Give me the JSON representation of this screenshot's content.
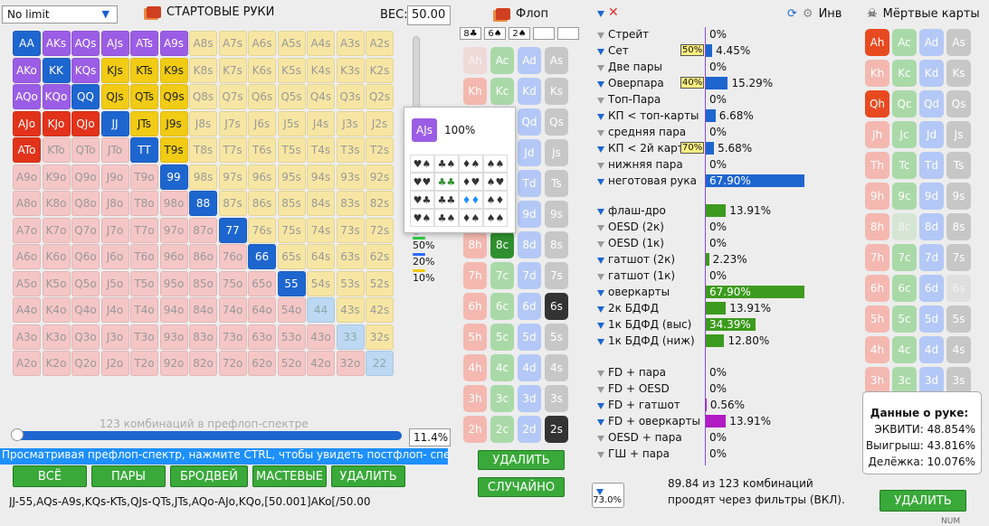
{
  "toolbar": {
    "limit": "No limit",
    "starting_hands": "СТАРТОВЫЕ РУКИ",
    "weight_label": "ВЕС:",
    "weight_value": "50.00"
  },
  "colors": {
    "pair_on": "#1e66cf",
    "suited_on": "#f1cb14",
    "offsuit_on": "#e2331a",
    "half": "#9b5de5",
    "accent_green": "#39a939"
  },
  "grid": {
    "rows": [
      [
        "AA",
        "AKs",
        "AQs",
        "AJs",
        "ATs",
        "A9s",
        "A8s",
        "A7s",
        "A6s",
        "A5s",
        "A4s",
        "A3s",
        "A2s"
      ],
      [
        "AKo",
        "KK",
        "KQs",
        "KJs",
        "KTs",
        "K9s",
        "K8s",
        "K7s",
        "K6s",
        "K5s",
        "K4s",
        "K3s",
        "K2s"
      ],
      [
        "AQo",
        "KQo",
        "QQ",
        "QJs",
        "QTs",
        "Q9s",
        "Q8s",
        "Q7s",
        "Q6s",
        "Q5s",
        "Q4s",
        "Q3s",
        "Q2s"
      ],
      [
        "AJo",
        "KJo",
        "QJo",
        "JJ",
        "JTs",
        "J9s",
        "J8s",
        "J7s",
        "J6s",
        "J5s",
        "J4s",
        "J3s",
        "J2s"
      ],
      [
        "ATo",
        "KTo",
        "QTo",
        "JTo",
        "TT",
        "T9s",
        "T8s",
        "T7s",
        "T6s",
        "T5s",
        "T4s",
        "T3s",
        "T2s"
      ],
      [
        "A9o",
        "K9o",
        "Q9o",
        "J9o",
        "T9o",
        "99",
        "98s",
        "97s",
        "96s",
        "95s",
        "94s",
        "93s",
        "92s"
      ],
      [
        "A8o",
        "K8o",
        "Q8o",
        "J8o",
        "T8o",
        "98o",
        "88",
        "87s",
        "86s",
        "85s",
        "84s",
        "83s",
        "82s"
      ],
      [
        "A7o",
        "K7o",
        "Q7o",
        "J7o",
        "T7o",
        "97o",
        "87o",
        "77",
        "76s",
        "75s",
        "74s",
        "73s",
        "72s"
      ],
      [
        "A6o",
        "K6o",
        "Q6o",
        "J6o",
        "T6o",
        "96o",
        "86o",
        "76o",
        "66",
        "65s",
        "64s",
        "63s",
        "62s"
      ],
      [
        "A5o",
        "K5o",
        "Q5o",
        "J5o",
        "T5o",
        "95o",
        "85o",
        "75o",
        "65o",
        "55",
        "54s",
        "53s",
        "52s"
      ],
      [
        "A4o",
        "K4o",
        "Q4o",
        "J4o",
        "T4o",
        "94o",
        "84o",
        "74o",
        "64o",
        "54o",
        "44",
        "43s",
        "42s"
      ],
      [
        "A3o",
        "K3o",
        "Q3o",
        "J3o",
        "T3o",
        "93o",
        "83o",
        "73o",
        "63o",
        "53o",
        "43o",
        "33",
        "32s"
      ],
      [
        "A2o",
        "K2o",
        "Q2o",
        "J2o",
        "T2o",
        "92o",
        "82o",
        "72o",
        "62o",
        "52o",
        "42o",
        "32o",
        "22"
      ]
    ],
    "selected": [
      "AA",
      "AKs",
      "AQs",
      "AJs",
      "ATs",
      "A9s",
      "AKo",
      "KK",
      "KQs",
      "KJs",
      "KTs",
      "K9s",
      "AQo",
      "KQo",
      "QQ",
      "QJs",
      "QTs",
      "Q9s",
      "AJo",
      "KJo",
      "QJo",
      "JJ",
      "JTs",
      "J9s",
      "ATo",
      "TT",
      "T9s",
      "99",
      "88",
      "77",
      "66",
      "55"
    ],
    "half": [
      "AKs",
      "AQs",
      "AJs",
      "ATs",
      "A9s",
      "AKo",
      "KQs",
      "AQo",
      "KQo"
    ]
  },
  "combo_text": "123 комбинаций в префлоп-спектре",
  "range_pct": "11.4%",
  "hint": "Просматривая префлоп-спектр, нажмите CTRL, чтобы увидеть постфлоп- спектр.",
  "buttons": {
    "all": "ВСЁ",
    "pairs": "ПАРЫ",
    "broadway": "БРОДВЕЙ",
    "suited": "МАСТЕВЫЕ",
    "delete": "УДАЛИТЬ",
    "random": "СЛУЧАЙНО"
  },
  "range_string": "JJ-55,AQs-A9s,KQs-KTs,QJs-QTs,JTs,AQo-AJo,KQo,[50.001]AKo[/50.00",
  "legend": [
    "50%",
    "20%",
    "10%"
  ],
  "popup": {
    "hand": "AJs",
    "pct": "100%"
  },
  "flop": {
    "title": "Флоп",
    "slots": [
      "8♣",
      "6♠",
      "2♠",
      "",
      ""
    ],
    "ranks": [
      "A",
      "K",
      "Q",
      "J",
      "T",
      "9",
      "8",
      "7",
      "6",
      "5",
      "4",
      "3",
      "2"
    ]
  },
  "stats": {
    "made": [
      {
        "label": "Стрейт",
        "val": "0%",
        "w": 0
      },
      {
        "label": "Сет",
        "val": "4.45%",
        "w": 4.45,
        "badge": "50%"
      },
      {
        "label": "Две пары",
        "val": "0%",
        "w": 0
      },
      {
        "label": "Оверпара",
        "val": "15.29%",
        "w": 15.29,
        "badge": "40%"
      },
      {
        "label": "Топ-Пара",
        "val": "0%",
        "w": 0
      },
      {
        "label": "КП < топ-карты",
        "val": "6.68%",
        "w": 6.68
      },
      {
        "label": "средняя пара",
        "val": "0%",
        "w": 0
      },
      {
        "label": "КП < 2й карт",
        "val": "5.68%",
        "w": 5.68,
        "badge": "70%"
      },
      {
        "label": "нижняя пара",
        "val": "0%",
        "w": 0
      },
      {
        "label": "неготовая рука",
        "val": "67.90%",
        "w": 67.9
      }
    ],
    "draws": [
      {
        "label": "флаш-дро",
        "val": "13.91%",
        "w": 13.91
      },
      {
        "label": "OESD (2к)",
        "val": "0%",
        "w": 0
      },
      {
        "label": "OESD (1к)",
        "val": "0%",
        "w": 0
      },
      {
        "label": "гатшот (2к)",
        "val": "2.23%",
        "w": 2.23
      },
      {
        "label": "гатшот (1к)",
        "val": "0%",
        "w": 0
      },
      {
        "label": "оверкарты",
        "val": "67.90%",
        "w": 67.9
      },
      {
        "label": "2к БДФД",
        "val": "13.91%",
        "w": 13.91
      },
      {
        "label": "1к БДФД (выс)",
        "val": "34.39%",
        "w": 34.39
      },
      {
        "label": "1к БДФД (ниж)",
        "val": "12.80%",
        "w": 12.8
      }
    ],
    "combos": [
      {
        "label": "FD + пара",
        "val": "0%",
        "w": 0
      },
      {
        "label": "FD + OESD",
        "val": "0%",
        "w": 0
      },
      {
        "label": "FD + гатшот",
        "val": "0.56%",
        "w": 0.56
      },
      {
        "label": "FD + оверкарты",
        "val": "13.91%",
        "w": 13.91
      },
      {
        "label": "OESD + пара",
        "val": "0%",
        "w": 0
      },
      {
        "label": "ГШ + пара",
        "val": "0%",
        "w": 0
      }
    ]
  },
  "inv_label": "Инв",
  "dead_cards_title": "Мёртвые карты",
  "equity": {
    "title": "Данные о руке:",
    "equity": "ЭКВИТИ: 48.854%",
    "win": "Выигрыш: 43.816%",
    "tie": "Делёжка: 10.076%"
  },
  "filter": {
    "badge": "73.0%",
    "line1": "89.84 из 123 комбинаций",
    "line2": "проодят через фильтры (ВКЛ)."
  },
  "num": "NUM"
}
